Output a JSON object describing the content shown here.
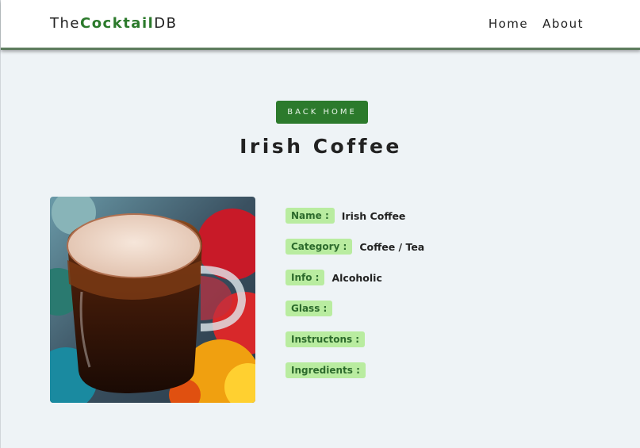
{
  "navbar": {
    "brand_prefix": "The",
    "brand_accent": "Cocktail",
    "brand_suffix": "DB",
    "links": [
      "Home",
      "About"
    ]
  },
  "page": {
    "back_button": "BACK HOME",
    "title": "Irish Coffee"
  },
  "details": [
    {
      "label": "Name :",
      "value": "Irish Coffee"
    },
    {
      "label": "Category :",
      "value": "Coffee / Tea"
    },
    {
      "label": "Info :",
      "value": "Alcoholic"
    },
    {
      "label": "Glass :",
      "value": ""
    },
    {
      "label": "Instructons :",
      "value": ""
    },
    {
      "label": "Ingredients :",
      "value": ""
    }
  ],
  "colors": {
    "accent": "#2c7a2c",
    "tag_bg": "#b9eca0",
    "page_bg": "#eef3f6"
  }
}
